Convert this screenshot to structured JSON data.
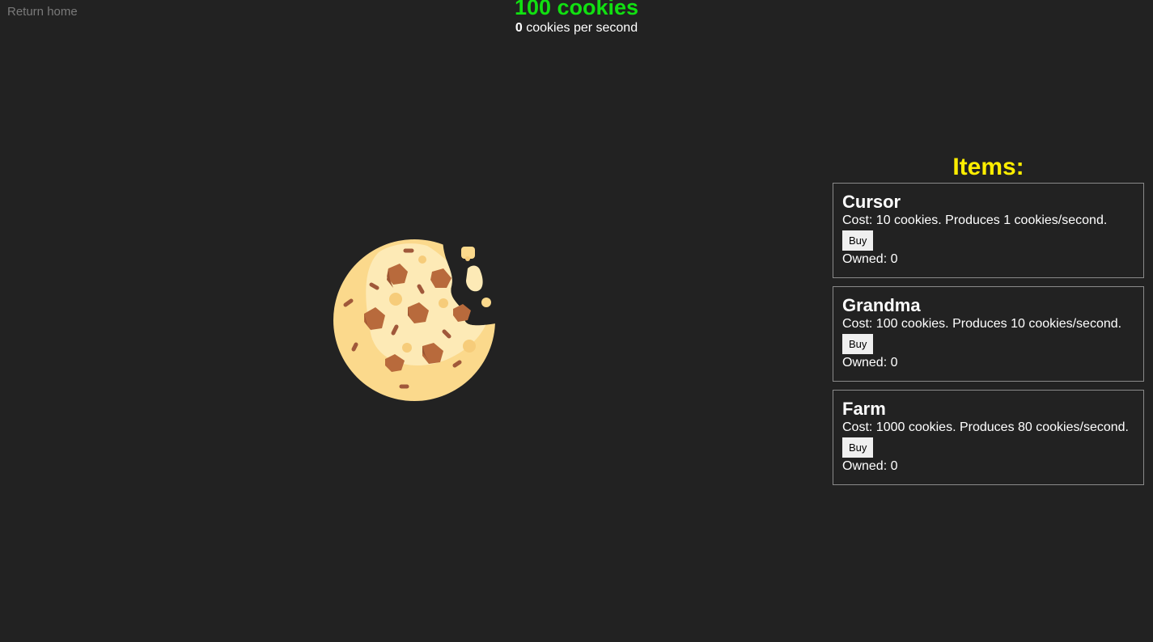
{
  "nav": {
    "return_home": "Return home"
  },
  "stats": {
    "cookies": "100 cookies",
    "cps_value": "0",
    "cps_label": " cookies per second"
  },
  "cookie": {
    "icon": "cookie-icon"
  },
  "store": {
    "title": "Items:",
    "items": [
      {
        "name": "Cursor",
        "desc": "Cost: 10 cookies. Produces 1 cookies/second.",
        "buy_label": "Buy",
        "owned": "Owned: 0"
      },
      {
        "name": "Grandma",
        "desc": "Cost: 100 cookies. Produces 10 cookies/second.",
        "buy_label": "Buy",
        "owned": "Owned: 0"
      },
      {
        "name": "Farm",
        "desc": "Cost: 1000 cookies. Produces 80 cookies/second.",
        "buy_label": "Buy",
        "owned": "Owned: 0"
      }
    ]
  },
  "colors": {
    "background": "#222222",
    "cookie_count": "#11e011",
    "items_title": "#ffee00",
    "muted_link": "#7a7a7a"
  }
}
